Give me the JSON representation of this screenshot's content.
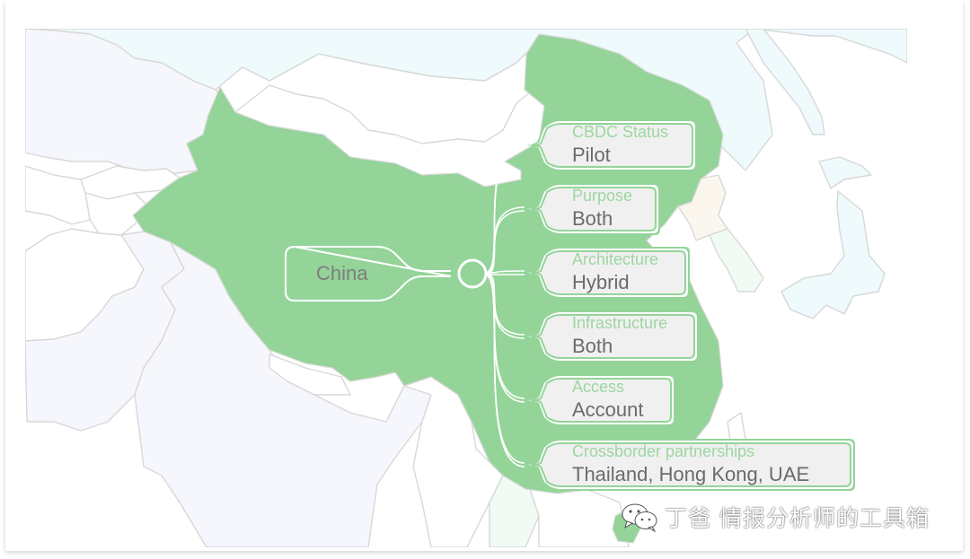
{
  "map": {
    "title_country": "China",
    "highlight_color": "#94d499",
    "fields": [
      {
        "label": "CBDC Status",
        "value": "Pilot"
      },
      {
        "label": "Purpose",
        "value": "Both"
      },
      {
        "label": "Architecture",
        "value": "Hybrid"
      },
      {
        "label": "Infrastructure",
        "value": "Both"
      },
      {
        "label": "Access",
        "value": "Account"
      },
      {
        "label": "Crossborder partnerships",
        "value": "Thailand, Hong Kong, UAE"
      }
    ]
  },
  "watermark": {
    "icon": "wechat-icon",
    "text": "丁爸 情报分析师的工具箱"
  }
}
